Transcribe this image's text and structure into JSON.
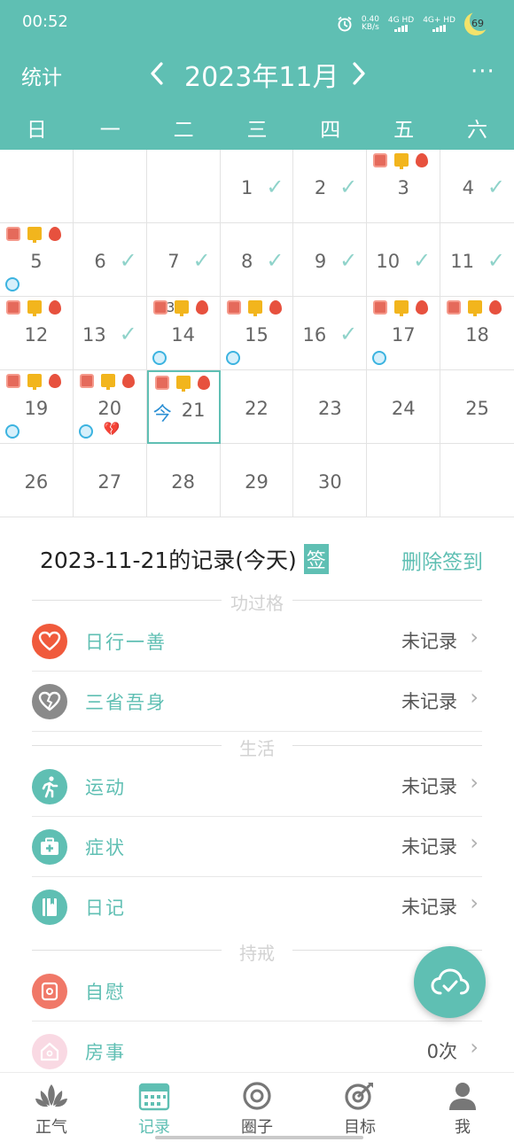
{
  "status_bar": {
    "time": "00:52",
    "speed": "0.40",
    "speed_unit": "KB/s",
    "net1": "4G HD",
    "net2": "4G+ HD",
    "battery": "69"
  },
  "header": {
    "stats_label": "统计",
    "month_title": "2023年11月",
    "prev_icon": "chevron-left-icon",
    "next_icon": "chevron-right-icon",
    "more_icon": "more-icon",
    "more_label": "···"
  },
  "weekdays": [
    "日",
    "一",
    "二",
    "三",
    "四",
    "五",
    "六"
  ],
  "calendar": {
    "days": [
      {
        "n": ""
      },
      {
        "n": ""
      },
      {
        "n": ""
      },
      {
        "n": "1",
        "check": true
      },
      {
        "n": "2",
        "check": true
      },
      {
        "n": "3",
        "icons": true
      },
      {
        "n": "4",
        "check": true
      },
      {
        "n": "5",
        "icons": true,
        "swirl": true
      },
      {
        "n": "6",
        "check": true
      },
      {
        "n": "7",
        "check": true
      },
      {
        "n": "8",
        "check": true
      },
      {
        "n": "9",
        "check": true
      },
      {
        "n": "10",
        "check": true
      },
      {
        "n": "11",
        "check": true
      },
      {
        "n": "12",
        "icons": true
      },
      {
        "n": "13",
        "check": true
      },
      {
        "n": "14",
        "icons": true,
        "swirl": true,
        "small": "3"
      },
      {
        "n": "15",
        "icons": true,
        "swirl": true
      },
      {
        "n": "16",
        "check": true
      },
      {
        "n": "17",
        "icons": true,
        "swirl": true
      },
      {
        "n": "18",
        "icons": true
      },
      {
        "n": "19",
        "icons": true,
        "swirl": true
      },
      {
        "n": "20",
        "icons": true,
        "swirl": true,
        "broken": true
      },
      {
        "n": "21",
        "icons": true,
        "today": true
      },
      {
        "n": "22"
      },
      {
        "n": "23"
      },
      {
        "n": "24"
      },
      {
        "n": "25"
      },
      {
        "n": "26"
      },
      {
        "n": "27"
      },
      {
        "n": "28"
      },
      {
        "n": "29"
      },
      {
        "n": "30"
      },
      {
        "n": ""
      },
      {
        "n": ""
      }
    ],
    "today_label": "今",
    "check_glyph": "✓",
    "broken_glyph": "💔"
  },
  "record": {
    "title": "2023-11-21的记录(今天)",
    "sign_badge": "签",
    "delete_label": "删除签到"
  },
  "sections": {
    "merit": "功过格",
    "life": "生活",
    "precept": "持戒"
  },
  "rows": [
    {
      "label": "日行一善",
      "value": "未记录",
      "icon": "heart-icon",
      "color": "#f05a3c"
    },
    {
      "label": "三省吾身",
      "value": "未记录",
      "icon": "broken-heart-icon",
      "color": "#8a8a8a"
    },
    {
      "label": "运动",
      "value": "未记录",
      "icon": "running-icon",
      "color": "#5fbfb3"
    },
    {
      "label": "症状",
      "value": "未记录",
      "icon": "medical-kit-icon",
      "color": "#5fbfb3"
    },
    {
      "label": "日记",
      "value": "未记录",
      "icon": "notebook-icon",
      "color": "#5fbfb3"
    },
    {
      "label": "自慰",
      "value": "",
      "icon": "tissue-roll-icon",
      "color": "#f07868"
    },
    {
      "label": "房事",
      "value": "0次",
      "icon": "house-icon",
      "color": "#f9d9e3"
    }
  ],
  "arrow_glyph": "›",
  "fab": {
    "icon": "cloud-sync-icon"
  },
  "bottom_nav": [
    {
      "label": "正气",
      "icon": "lotus-icon"
    },
    {
      "label": "记录",
      "icon": "calendar-icon",
      "active": true
    },
    {
      "label": "圈子",
      "icon": "circle-icon"
    },
    {
      "label": "目标",
      "icon": "target-icon"
    },
    {
      "label": "我",
      "icon": "user-icon"
    }
  ],
  "colors": {
    "accent": "#5fbfb3",
    "today_blue": "#2b8fd4",
    "check": "#8fd3ca"
  }
}
